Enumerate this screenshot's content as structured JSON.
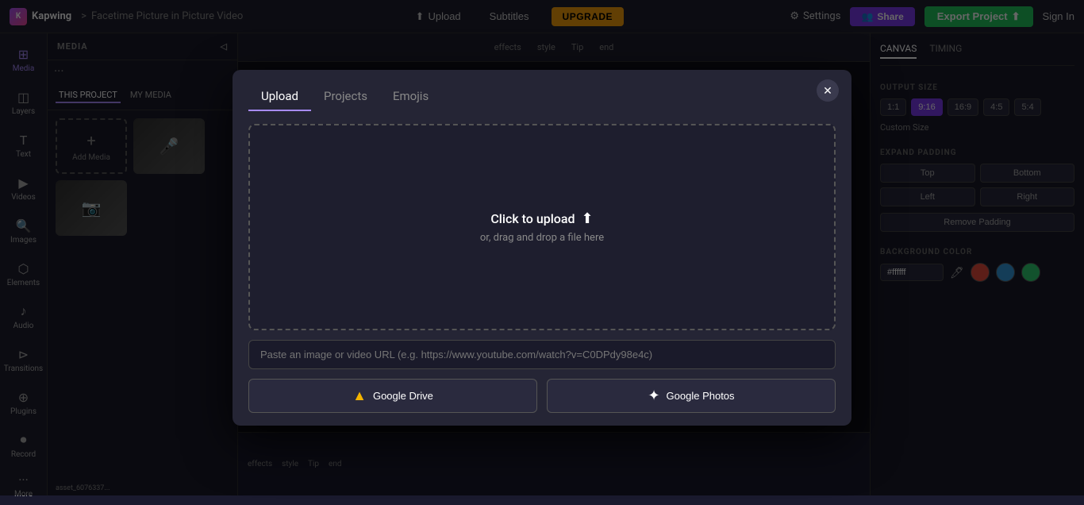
{
  "app": {
    "logo_text": "K",
    "brand": "Kapwing",
    "separator": ">",
    "project_title": "Facetime Picture in Picture Video"
  },
  "topnav": {
    "upload_label": "Upload",
    "subtitles_label": "Subtitles",
    "upgrade_label": "UPGRADE",
    "settings_label": "Settings",
    "share_label": "Share",
    "export_label": "Export Project",
    "signin_label": "Sign In"
  },
  "sidebar": {
    "items": [
      {
        "id": "media",
        "icon": "⊞",
        "label": "Media"
      },
      {
        "id": "layers",
        "icon": "◫",
        "label": "Layers"
      },
      {
        "id": "text",
        "icon": "T",
        "label": "Text"
      },
      {
        "id": "videos",
        "icon": "▶",
        "label": "Videos"
      },
      {
        "id": "images",
        "icon": "🔍",
        "label": "Images"
      },
      {
        "id": "elements",
        "icon": "⬡",
        "label": "Elements"
      },
      {
        "id": "audio",
        "icon": "♪",
        "label": "Audio"
      },
      {
        "id": "transitions",
        "icon": "⊳⊴",
        "label": "Transitions"
      },
      {
        "id": "plugins",
        "icon": "⊕",
        "label": "Plugins"
      }
    ],
    "record_label": "Record",
    "more_label": "More"
  },
  "media_panel": {
    "header": "MEDIA",
    "tabs": [
      {
        "id": "this_project",
        "label": "THIS PROJECT"
      },
      {
        "id": "my_media",
        "label": "MY MEDIA"
      }
    ],
    "add_media_label": "Add Media",
    "filename": "asset_6076337..."
  },
  "right_panel": {
    "tabs": [
      {
        "id": "canvas",
        "label": "CANVAS"
      },
      {
        "id": "timing",
        "label": "TIMING"
      }
    ],
    "output_size_label": "OUTPUT SIZE",
    "size_options": [
      "1:1",
      "9:16",
      "16:9",
      "4:5",
      "5:4"
    ],
    "active_size": "9:16",
    "custom_size_label": "Custom Size",
    "expand_padding_label": "EXPAND PADDING",
    "padding_options": [
      "Top",
      "Bottom",
      "Left",
      "Right"
    ],
    "remove_padding_label": "Remove Padding",
    "background_color_label": "BACKGROUND COLOR",
    "color_hex": "#ffffff",
    "color_swatches": [
      "#e74c3c",
      "#3498db",
      "#2ecc71"
    ]
  },
  "modal": {
    "tabs": [
      {
        "id": "upload",
        "label": "Upload"
      },
      {
        "id": "projects",
        "label": "Projects"
      },
      {
        "id": "emojis",
        "label": "Emojis"
      }
    ],
    "active_tab": "Upload",
    "close_icon": "✕",
    "dropzone_main_text": "Click to upload",
    "dropzone_sub_text": "or, drag and drop a file here",
    "url_placeholder": "Paste an image or video URL (e.g. https://www.youtube.com/watch?v=C0DPdy98e4c)",
    "google_drive_label": "Google Drive",
    "google_photos_label": "Google Photos"
  },
  "timeline": {
    "labels": [
      "effects",
      "style",
      "Tip",
      "end"
    ]
  }
}
